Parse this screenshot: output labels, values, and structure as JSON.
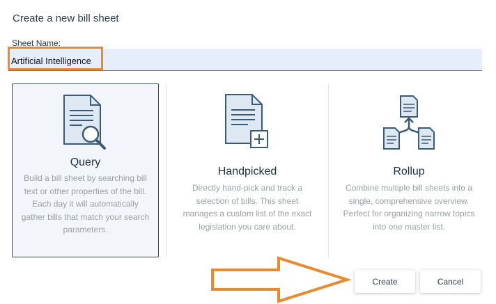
{
  "dialog": {
    "title": "Create a new bill sheet",
    "sheet_name_label": "Sheet Name:",
    "sheet_name_value": "Artificial Intelligence"
  },
  "cards": [
    {
      "title": "Query",
      "description": "Build a bill sheet by searching bill text or other properties of the bill. Each day it will automatically gather bills that match your search parameters.",
      "icon": "query-document-icon",
      "selected": true
    },
    {
      "title": "Handpicked",
      "description": "Directly hand-pick and track a selection of bills. This sheet manages a custom list of the exact legislation you care about.",
      "icon": "handpicked-document-icon",
      "selected": false
    },
    {
      "title": "Rollup",
      "description": "Combine multiple bill sheets into a single, comprehensive overview. Perfect for organizing narrow topics into one master list.",
      "icon": "rollup-documents-icon",
      "selected": false
    }
  ],
  "buttons": {
    "create": "Create",
    "cancel": "Cancel"
  },
  "colors": {
    "highlight": "#e98a2f",
    "field_bg": "#e7eefb",
    "icon_stroke": "#3d5a74",
    "icon_fill": "#dde8f2"
  }
}
